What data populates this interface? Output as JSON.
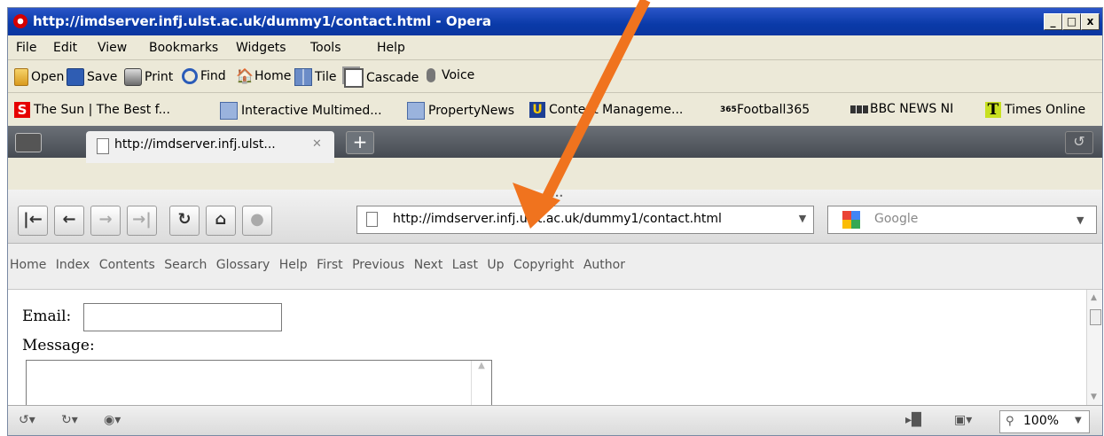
{
  "window": {
    "title": "http://imdserver.infj.ulst.ac.uk/dummy1/contact.html - Opera",
    "controls": {
      "minimize": "_",
      "maximize": "□",
      "close": "x"
    }
  },
  "menu": [
    "File",
    "Edit",
    "View",
    "Bookmarks",
    "Widgets",
    "Tools",
    "Help"
  ],
  "toolbar": [
    {
      "label": "Open",
      "icon": "open-folder-icon"
    },
    {
      "label": "Save",
      "icon": "save-disk-icon"
    },
    {
      "label": "Print",
      "icon": "printer-icon"
    },
    {
      "label": "Find",
      "icon": "magnifier-icon"
    },
    {
      "label": "Home",
      "icon": "home-icon"
    },
    {
      "label": "Tile",
      "icon": "tile-windows-icon"
    },
    {
      "label": "Cascade",
      "icon": "cascade-windows-icon"
    },
    {
      "label": "Voice",
      "icon": "microphone-icon"
    }
  ],
  "bookmarks": [
    {
      "label": "The Sun | The Best f...",
      "icon": "the-sun-favicon"
    },
    {
      "label": "Interactive Multimed...",
      "icon": "generic-favicon"
    },
    {
      "label": "PropertyNews",
      "icon": "generic-favicon"
    },
    {
      "label": "Content Manageme...",
      "icon": "university-favicon"
    },
    {
      "label": "Football365",
      "icon": "football365-favicon"
    },
    {
      "label": "BBC NEWS NI",
      "icon": "bbc-favicon"
    },
    {
      "label": "Times Online",
      "icon": "times-favicon"
    }
  ],
  "tabs": [
    {
      "label": "http://imdserver.infj.ulst...",
      "close": "✕"
    }
  ],
  "address": {
    "url": "http://imdserver.infj.ulst.ac.uk/dummy1/contact.html",
    "search_placeholder": "Google",
    "dots": "•••"
  },
  "nav_links": [
    "Home",
    "Index",
    "Contents",
    "Search",
    "Glossary",
    "Help",
    "First",
    "Previous",
    "Next",
    "Last",
    "Up",
    "Copyright",
    "Author"
  ],
  "form": {
    "email_label": "Email:",
    "email_value": "",
    "message_label": "Message:",
    "message_value": ""
  },
  "status": {
    "zoom": "100%"
  },
  "colors": {
    "title_bar": "#0a3aa8",
    "arrow": "#f0731e",
    "chrome": "#ece9d8"
  }
}
